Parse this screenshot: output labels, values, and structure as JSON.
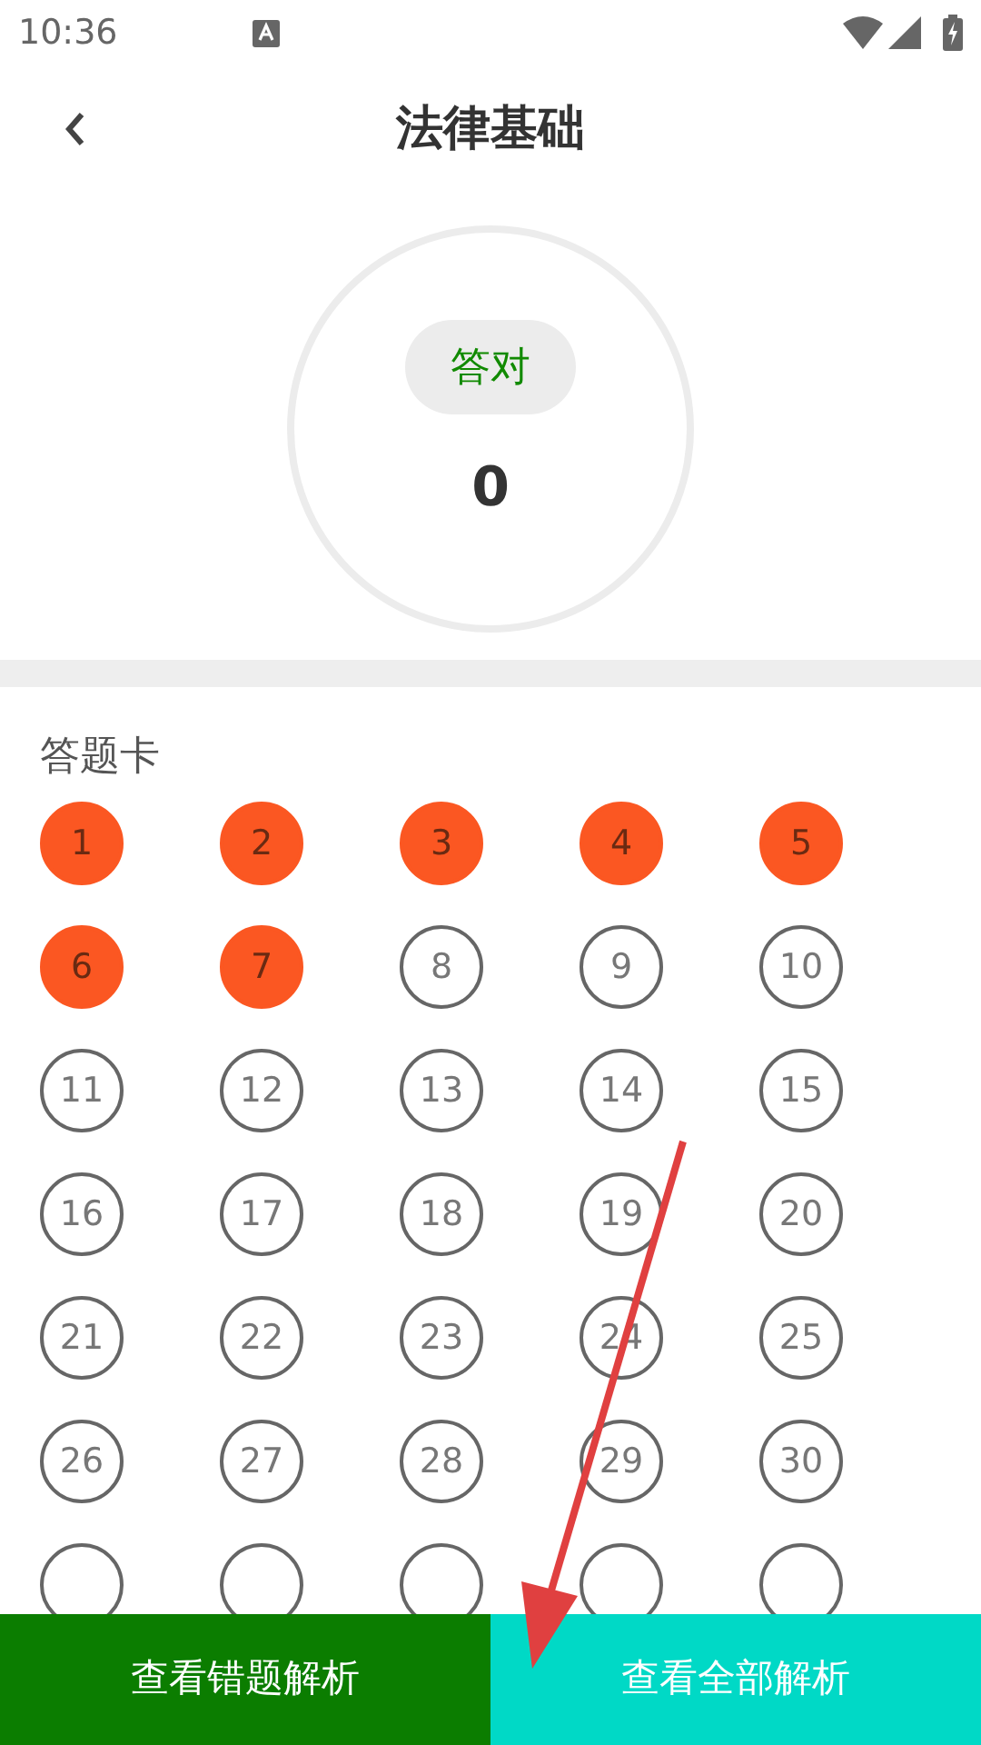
{
  "status_bar": {
    "time": "10:36"
  },
  "header": {
    "title": "法律基础"
  },
  "score": {
    "label": "答对",
    "value": "0"
  },
  "answer_card": {
    "title": "答题卡",
    "questions": [
      {
        "label": "1",
        "answered": true
      },
      {
        "label": "2",
        "answered": true
      },
      {
        "label": "3",
        "answered": true
      },
      {
        "label": "4",
        "answered": true
      },
      {
        "label": "5",
        "answered": true
      },
      {
        "label": "6",
        "answered": true
      },
      {
        "label": "7",
        "answered": true
      },
      {
        "label": "8",
        "answered": false
      },
      {
        "label": "9",
        "answered": false
      },
      {
        "label": "10",
        "answered": false
      },
      {
        "label": "11",
        "answered": false
      },
      {
        "label": "12",
        "answered": false
      },
      {
        "label": "13",
        "answered": false
      },
      {
        "label": "14",
        "answered": false
      },
      {
        "label": "15",
        "answered": false
      },
      {
        "label": "16",
        "answered": false
      },
      {
        "label": "17",
        "answered": false
      },
      {
        "label": "18",
        "answered": false
      },
      {
        "label": "19",
        "answered": false
      },
      {
        "label": "20",
        "answered": false
      },
      {
        "label": "21",
        "answered": false
      },
      {
        "label": "22",
        "answered": false
      },
      {
        "label": "23",
        "answered": false
      },
      {
        "label": "24",
        "answered": false
      },
      {
        "label": "25",
        "answered": false
      },
      {
        "label": "26",
        "answered": false
      },
      {
        "label": "27",
        "answered": false
      },
      {
        "label": "28",
        "answered": false
      },
      {
        "label": "29",
        "answered": false
      },
      {
        "label": "30",
        "answered": false
      }
    ],
    "cut_off_questions": [
      {
        "answered": false
      },
      {
        "answered": false
      },
      {
        "answered": false
      },
      {
        "answered": false
      },
      {
        "answered": false
      }
    ]
  },
  "buttons": [
    {
      "label": "查看错题解析",
      "kind": "wrong"
    },
    {
      "label": "查看全部解析",
      "kind": "all"
    }
  ]
}
